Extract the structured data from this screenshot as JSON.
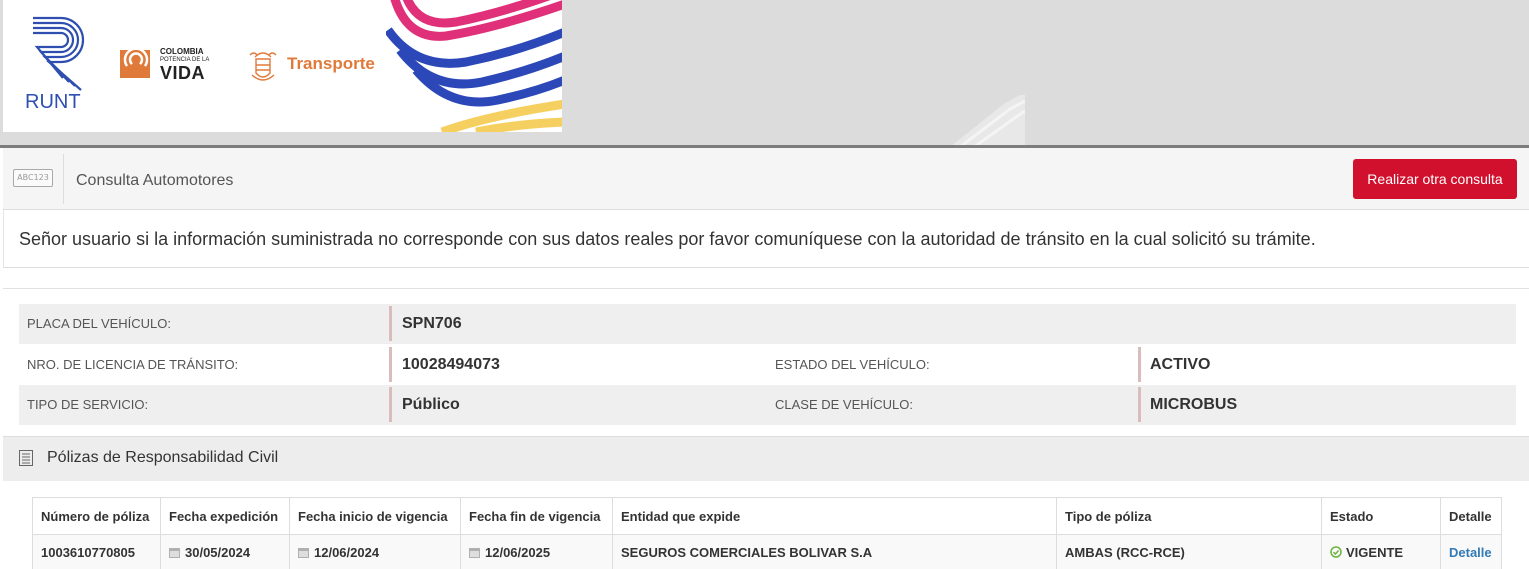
{
  "banner": {
    "runt_label": "RUNT",
    "colombia_line1": "COLOMBIA",
    "colombia_line2": "POTENCIA DE LA",
    "colombia_line3": "VIDA",
    "transporte_label": "Transporte",
    "colors": {
      "runt_blue": "#2e4fb0",
      "transporte_orange": "#e07a3a",
      "wave_pink": "#e0307a",
      "wave_blue": "#2c48b8",
      "wave_yellow": "#f5d060"
    }
  },
  "consulta": {
    "icon_label": "ABC123",
    "title": "Consulta Automotores",
    "button_label": "Realizar otra consulta",
    "button_color": "#d0102c"
  },
  "notice": {
    "text": "Señor usuario si la información suministrada no corresponde con sus datos reales por favor comuníquese con la autoridad de tránsito en la cual solicitó su trámite."
  },
  "vehicle": {
    "placa_label": "PLACA DEL VEHÍCULO:",
    "placa_value": "SPN706",
    "licencia_label": "NRO. DE LICENCIA DE TRÁNSITO:",
    "licencia_value": "10028494073",
    "estado_label": "ESTADO DEL VEHÍCULO:",
    "estado_value": "ACTIVO",
    "servicio_label": "TIPO DE SERVICIO:",
    "servicio_value": "Público",
    "clase_label": "CLASE DE VEHÍCULO:",
    "clase_value": "MICROBUS"
  },
  "polizas": {
    "section_title": "Pólizas de Responsabilidad Civil",
    "headers": {
      "numero": "Número de póliza",
      "expedicion": "Fecha expedición",
      "inicio": "Fecha inicio de vigencia",
      "fin": "Fecha fin de vigencia",
      "entidad": "Entidad que expide",
      "tipo": "Tipo de póliza",
      "estado": "Estado",
      "detalle": "Detalle"
    },
    "rows": [
      {
        "numero": "1003610770805",
        "expedicion": "30/05/2024",
        "inicio": "12/06/2024",
        "fin": "12/06/2025",
        "entidad": "SEGUROS COMERCIALES BOLIVAR S.A",
        "tipo": "AMBAS (RCC-RCE)",
        "estado": "VIGENTE",
        "detalle": "Detalle"
      }
    ]
  }
}
